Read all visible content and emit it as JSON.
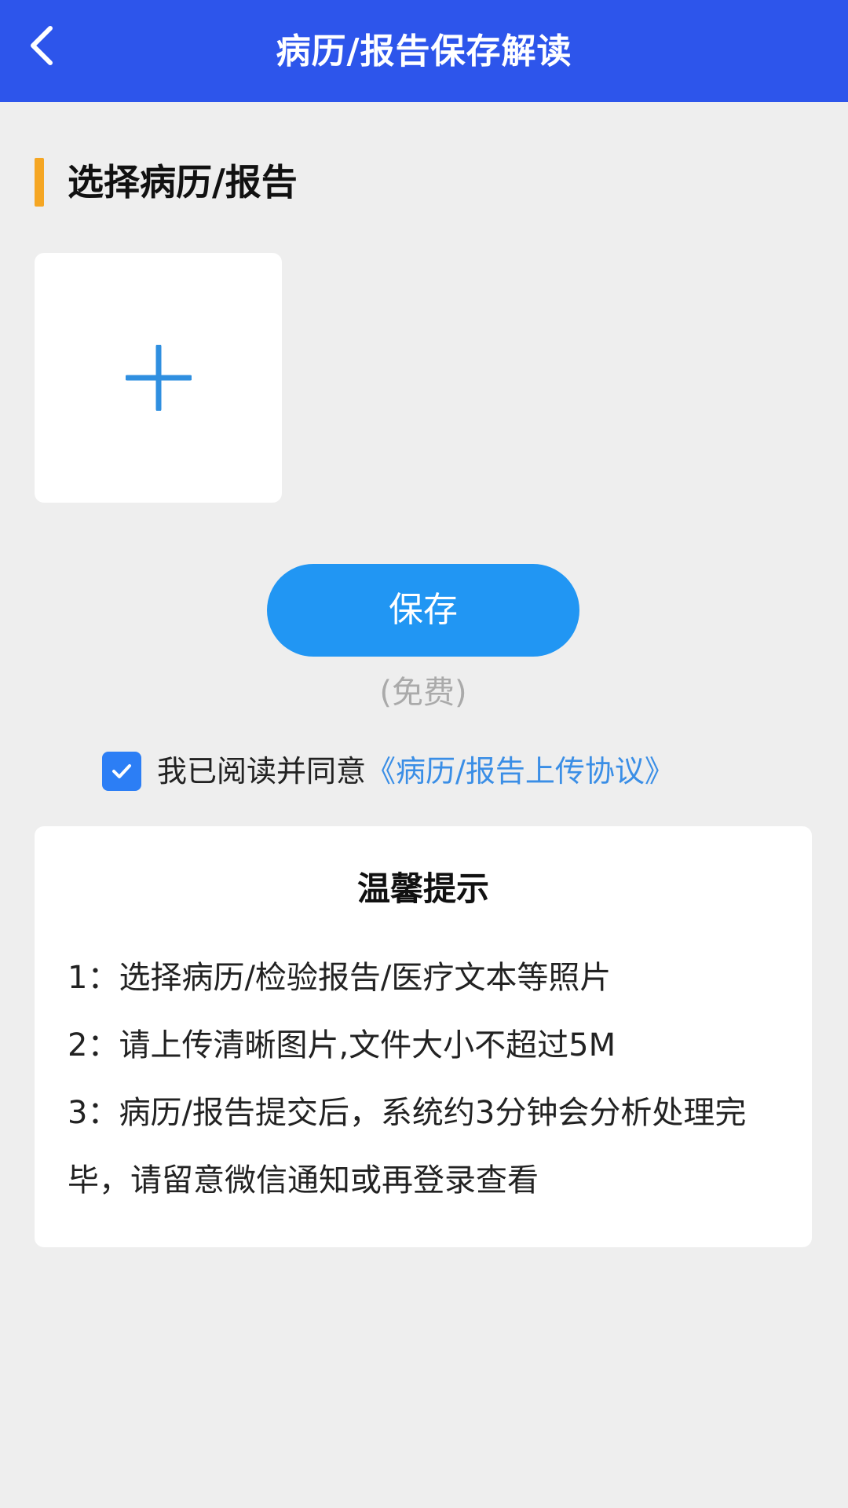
{
  "header": {
    "title": "病历/报告保存解读",
    "back_icon": "chevron-left-icon",
    "background_color": "#2d55eb"
  },
  "section": {
    "title": "选择病历/报告",
    "accent_color": "#f5a623"
  },
  "upload": {
    "icon": "plus-icon",
    "icon_color": "#2f8fe0"
  },
  "save": {
    "label": "保存",
    "note": "(免费)",
    "color": "#2196f3"
  },
  "agreement": {
    "checked": true,
    "text": "我已阅读并同意",
    "link": "《病历/报告上传协议》",
    "link_color": "#3a8ee6"
  },
  "tips": {
    "title": "温馨提示",
    "items": [
      "1：选择病历/检验报告/医疗文本等照片",
      "2：请上传清晰图片,文件大小不超过5M",
      "3：病历/报告提交后，系统约3分钟会分析处理完毕，请留意微信通知或再登录查看"
    ]
  }
}
